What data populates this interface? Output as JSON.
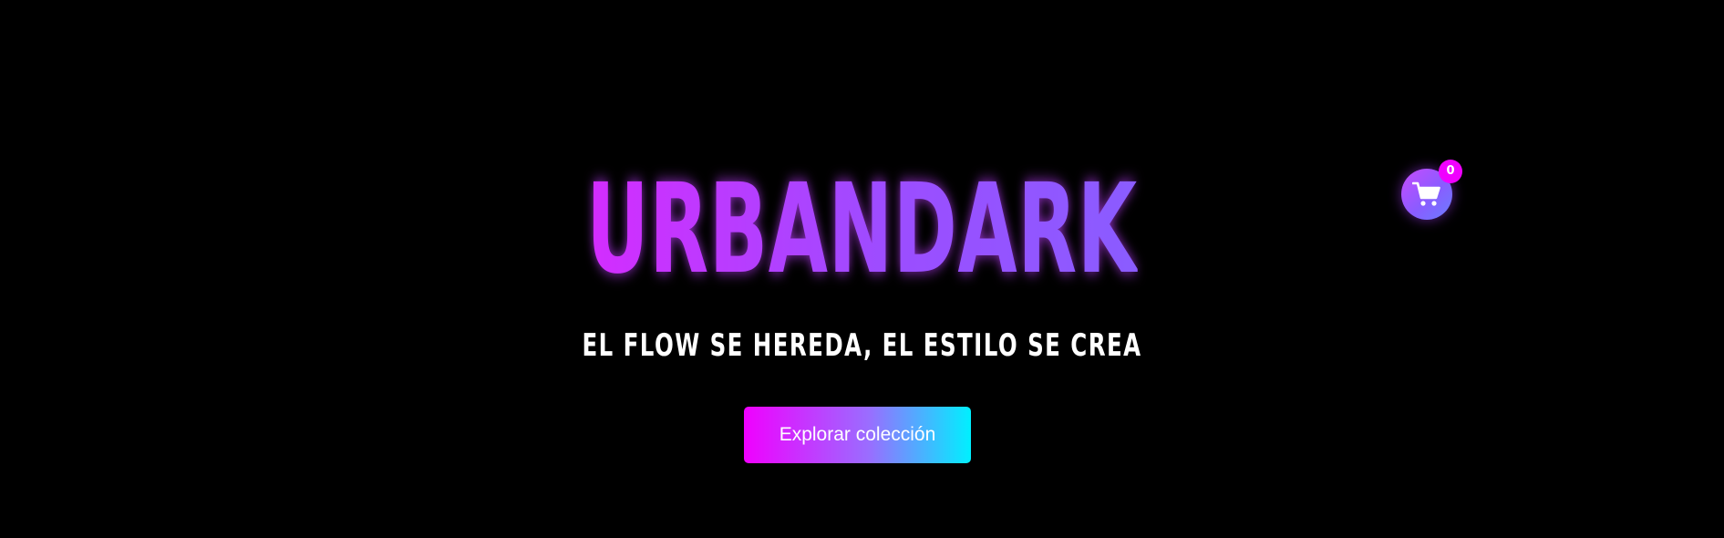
{
  "brand": {
    "title": "URBANDARK",
    "tagline": "EL FLOW SE HEREDA, EL ESTILO SE CREA"
  },
  "hero": {
    "cta_label": "Explorar colección"
  },
  "cart": {
    "icon": "shopping-cart-icon",
    "count": "0"
  },
  "colors": {
    "background": "#000000",
    "accent_magenta": "#f000ff",
    "accent_purple": "#9c4dff",
    "accent_cyan": "#00f0ff",
    "text": "#ffffff"
  }
}
